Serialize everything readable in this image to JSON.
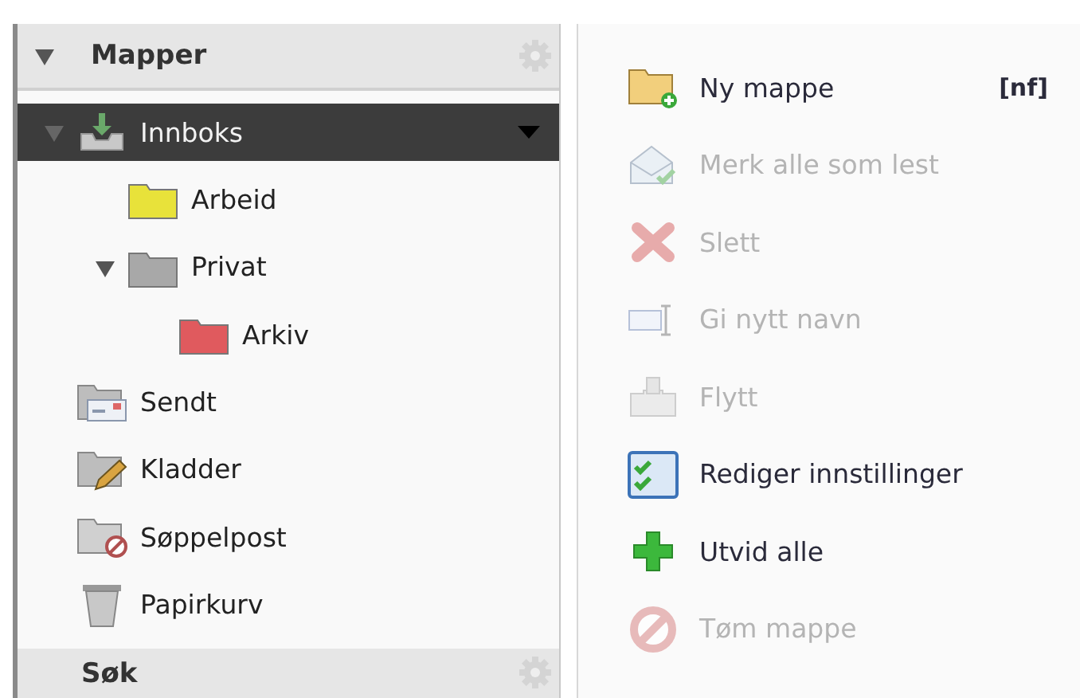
{
  "folders_panel": {
    "title": "Mapper",
    "expanded": true
  },
  "folders": [
    {
      "label": "Innboks",
      "kind": "inbox",
      "expanded": true,
      "selected": true,
      "children": [
        {
          "label": "Arbeid",
          "kind": "folder",
          "color": "#e8e23a",
          "selected": false
        },
        {
          "label": "Privat",
          "kind": "folder",
          "color": "#a8a8a8",
          "expanded": true,
          "selected": false,
          "children": [
            {
              "label": "Arkiv",
              "kind": "folder",
              "color": "#e05a5e",
              "selected": false
            }
          ]
        }
      ]
    },
    {
      "label": "Sendt",
      "kind": "sent",
      "selected": false
    },
    {
      "label": "Kladder",
      "kind": "drafts",
      "selected": false
    },
    {
      "label": "Søppelpost",
      "kind": "spam",
      "selected": false
    },
    {
      "label": "Papirkurv",
      "kind": "trash",
      "selected": false
    }
  ],
  "search_panel": {
    "title": "Søk"
  },
  "context_menu": [
    {
      "label": "Ny mappe",
      "shortcut": "[nf]",
      "kind": "new-folder",
      "disabled": false
    },
    {
      "label": "Merk alle som lest",
      "kind": "mark-read",
      "disabled": true
    },
    {
      "label": "Slett",
      "kind": "delete",
      "disabled": true
    },
    {
      "label": "Gi nytt navn",
      "kind": "rename",
      "disabled": true
    },
    {
      "label": "Flytt",
      "kind": "move",
      "disabled": true
    },
    {
      "label": "Rediger innstillinger",
      "kind": "settings",
      "disabled": false
    },
    {
      "label": "Utvid alle",
      "kind": "expand",
      "disabled": false
    },
    {
      "label": "Tøm mappe",
      "kind": "empty",
      "disabled": true
    }
  ]
}
